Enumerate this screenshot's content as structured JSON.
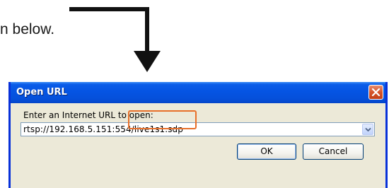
{
  "document": {
    "instruction_fragment": "n below."
  },
  "dialog": {
    "title": "Open URL",
    "prompt": "Enter an Internet URL to open:",
    "url_value": "rtsp://192.168.5.151:554/live1s1.sdp",
    "ok_label": "OK",
    "cancel_label": "Cancel"
  },
  "icons": {
    "close": "close-icon",
    "dropdown": "chevron-down-icon",
    "pointer": "down-arrow-icon"
  },
  "colors": {
    "titlebar": "#0554e3",
    "dialog_bg": "#ece9d8",
    "highlight": "#e8702a",
    "close_button": "#d6542a"
  }
}
